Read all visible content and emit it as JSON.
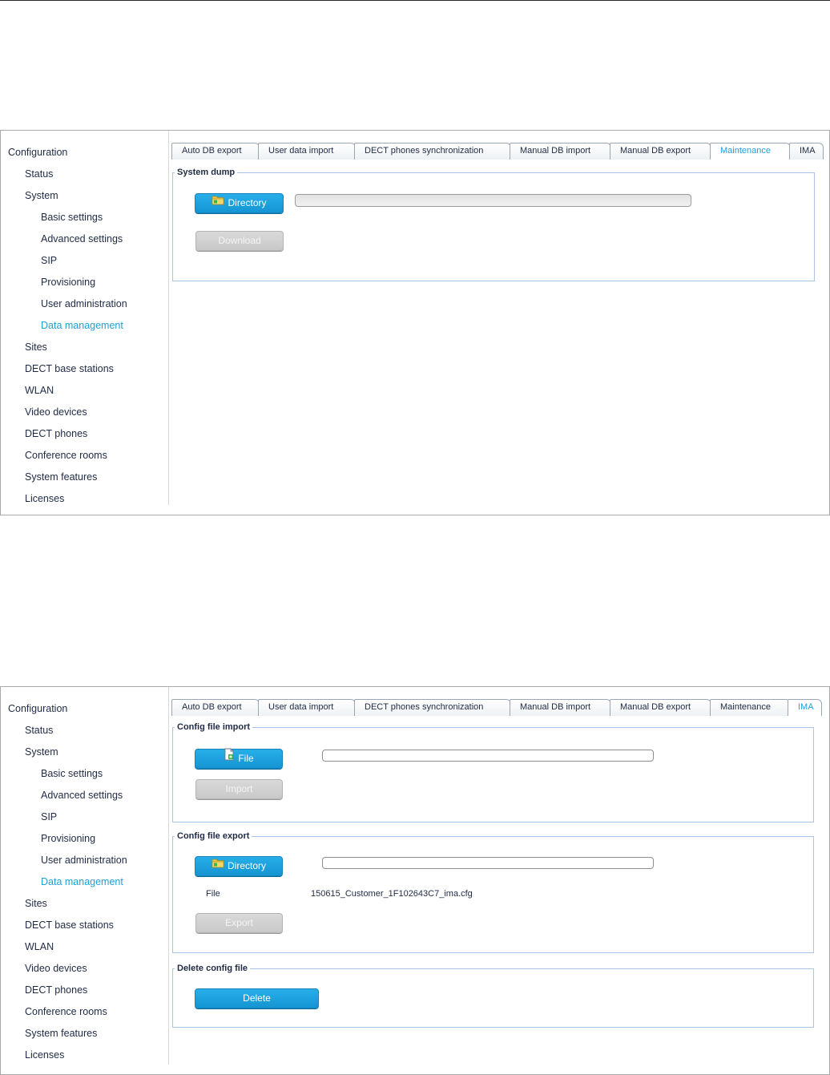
{
  "nav": {
    "items": [
      {
        "label": "Configuration"
      },
      {
        "label": "Status"
      },
      {
        "label": "System"
      },
      {
        "label": "Basic settings"
      },
      {
        "label": "Advanced settings"
      },
      {
        "label": "SIP"
      },
      {
        "label": "Provisioning"
      },
      {
        "label": "User administration"
      },
      {
        "label": "Data management"
      },
      {
        "label": "Sites"
      },
      {
        "label": "DECT base stations"
      },
      {
        "label": "WLAN"
      },
      {
        "label": "Video devices"
      },
      {
        "label": "DECT phones"
      },
      {
        "label": "Conference rooms"
      },
      {
        "label": "System features"
      },
      {
        "label": "Licenses"
      }
    ],
    "active": "Data management"
  },
  "tabs": [
    {
      "label": "Auto DB export"
    },
    {
      "label": "User data import"
    },
    {
      "label": "DECT phones synchronization"
    },
    {
      "label": "Manual DB import"
    },
    {
      "label": "Manual DB export"
    },
    {
      "label": "Maintenance"
    },
    {
      "label": "IMA"
    }
  ],
  "screen1": {
    "active_tab": "Maintenance",
    "system_dump": {
      "legend": "System dump",
      "directory_button": "Directory",
      "directory_path": "",
      "download_button": "Download"
    }
  },
  "screen2": {
    "active_tab": "IMA",
    "config_import": {
      "legend": "Config file import",
      "file_button": "File",
      "file_path": "",
      "import_button": "Import"
    },
    "config_export": {
      "legend": "Config file export",
      "directory_button": "Directory",
      "directory_path": "",
      "file_label": "File",
      "file_name": "150615_Customer_1F102643C7_ima.cfg",
      "export_button": "Export"
    },
    "delete_config": {
      "legend": "Delete config file",
      "delete_button": "Delete"
    }
  },
  "colors": {
    "accent": "#1fa0d8",
    "button_blue": "#1a9fdc",
    "button_disabled": "#cfcfcf",
    "fieldset_border": "#a9c6e8",
    "nav_text": "#1f2a44"
  },
  "icons": {
    "directory": "folder-icon",
    "file": "file-add-icon"
  }
}
